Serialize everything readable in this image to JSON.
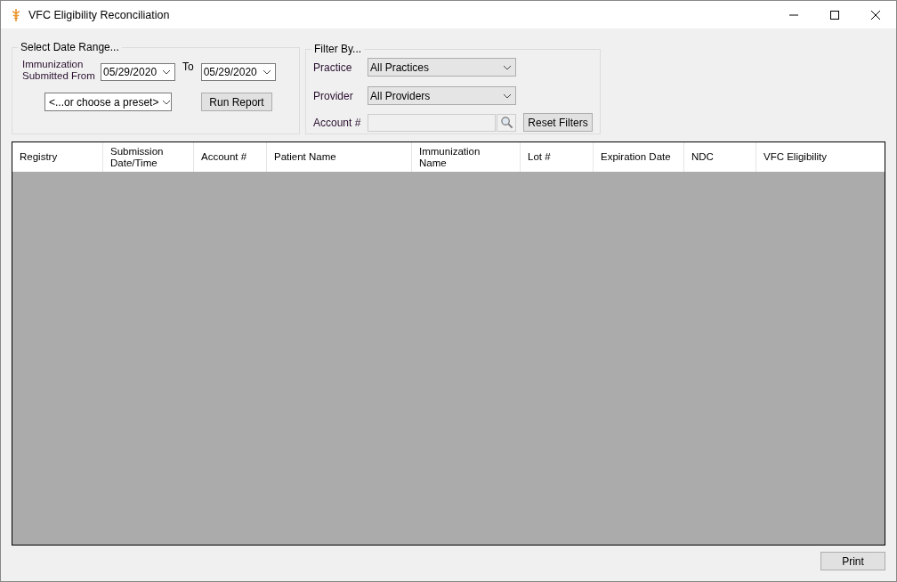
{
  "window": {
    "title": "VFC Eligibility Reconciliation"
  },
  "date_range": {
    "legend": "Select Date Range...",
    "from_label": "Immunization Submitted From",
    "from_value": "05/29/2020",
    "to_label": "To",
    "to_value": "05/29/2020",
    "preset": "<...or choose a preset>",
    "run_button": "Run Report"
  },
  "filter": {
    "legend": "Filter By...",
    "practice_label": "Practice",
    "practice_value": "All Practices",
    "provider_label": "Provider",
    "provider_value": "All Providers",
    "account_label": "Account #",
    "account_disabled": true,
    "reset_button": "Reset Filters"
  },
  "table": {
    "columns": [
      "Registry",
      "Submission Date/Time",
      "Account #",
      "Patient Name",
      "Immunization Name",
      "Lot #",
      "Expiration Date",
      "NDC",
      "VFC Eligibility"
    ]
  },
  "print_button": "Print"
}
